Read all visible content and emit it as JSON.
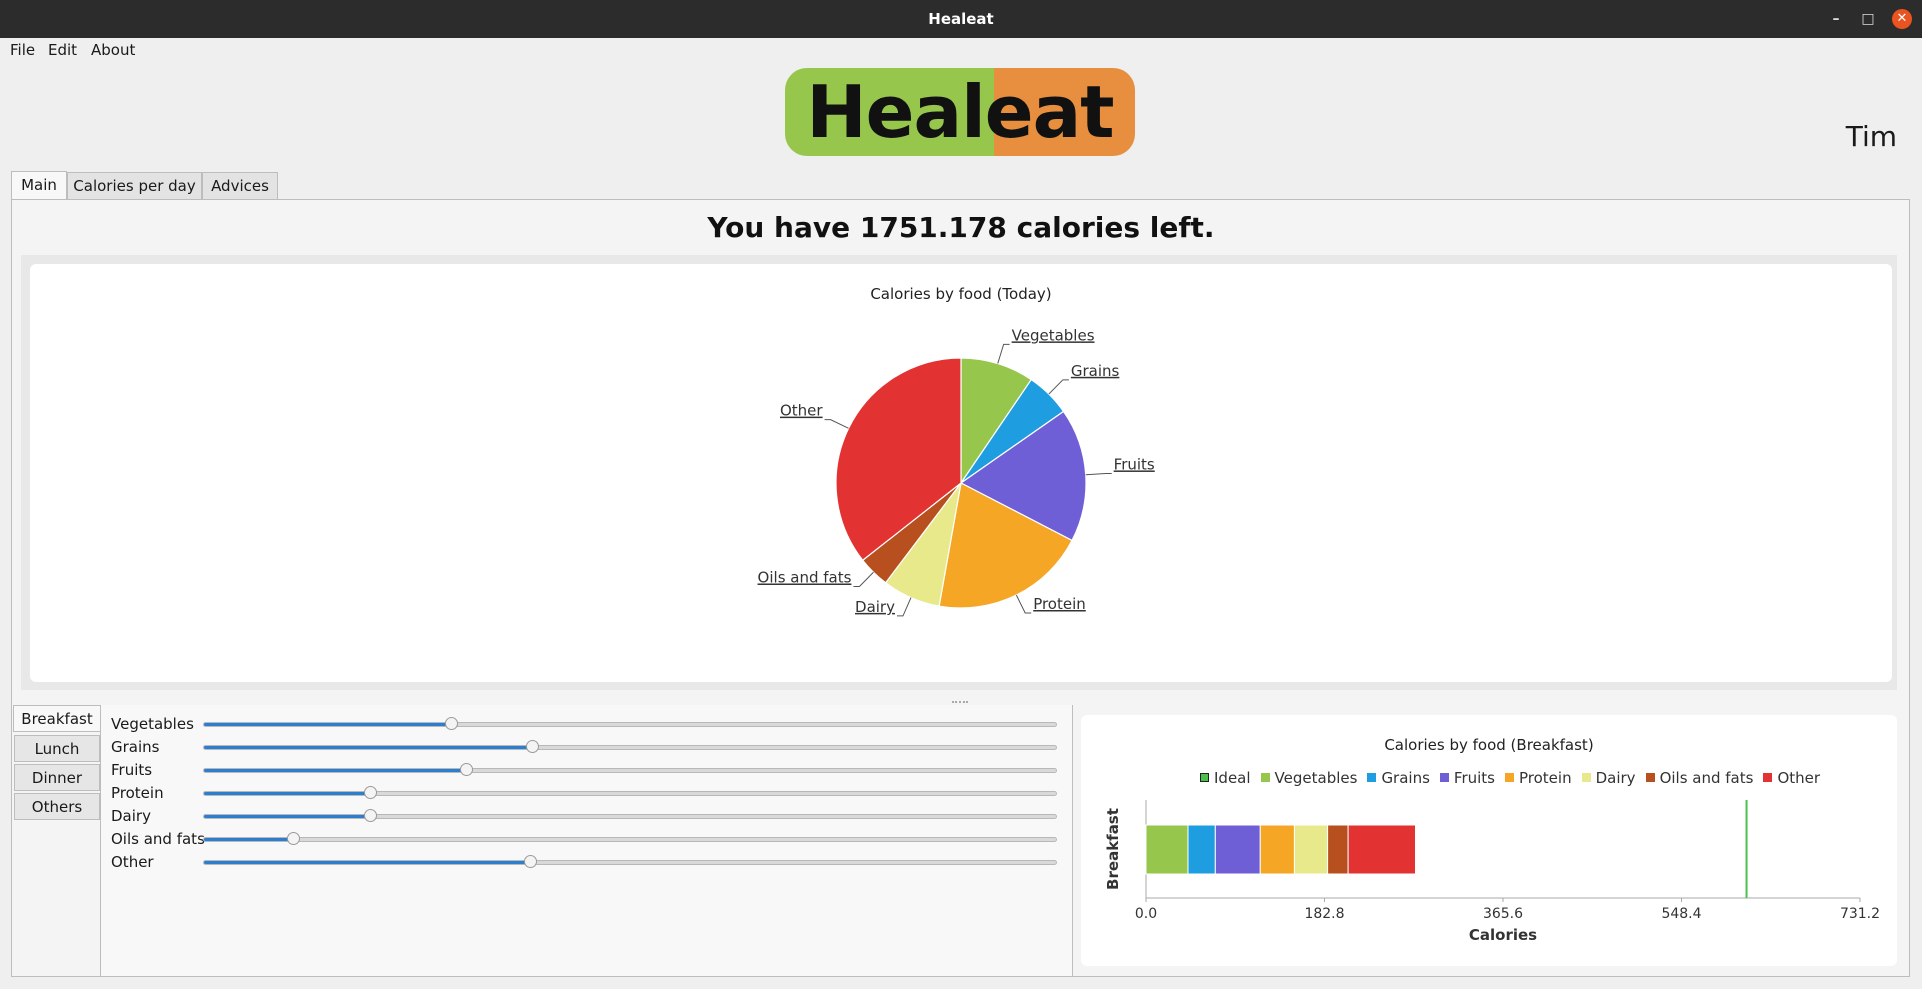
{
  "window": {
    "title": "Healeat"
  },
  "menu": {
    "file": "File",
    "edit": "Edit",
    "about": "About"
  },
  "logo_text": "Healeat",
  "user": {
    "name": "Tim"
  },
  "tabs": [
    "Main",
    "Calories per day",
    "Advices"
  ],
  "main": {
    "calories_left": "You have 1751.178 calories left."
  },
  "meal_tabs": [
    "Breakfast",
    "Lunch",
    "Dinner",
    "Others"
  ],
  "sliders": [
    {
      "label": "Vegetables",
      "value": 0.29
    },
    {
      "label": "Grains",
      "value": 0.385
    },
    {
      "label": "Fruits",
      "value": 0.308
    },
    {
      "label": "Protein",
      "value": 0.195
    },
    {
      "label": "Dairy",
      "value": 0.196
    },
    {
      "label": "Oils and fats",
      "value": 0.105
    },
    {
      "label": "Other",
      "value": 0.383
    }
  ],
  "colors": {
    "Vegetables": "#97c64d",
    "Grains": "#1e9ee0",
    "Fruits": "#6f5fd6",
    "Protein": "#f4a624",
    "Dairy": "#e8e98a",
    "Oils and fats": "#b84f1e",
    "Other": "#e23232",
    "Ideal": "#4cc04c"
  },
  "chart_data": [
    {
      "type": "pie",
      "title": "Calories by food (Today)",
      "categories": [
        "Vegetables",
        "Grains",
        "Fruits",
        "Protein",
        "Dairy",
        "Oils and fats",
        "Other"
      ],
      "values": [
        9.5,
        5.8,
        17.3,
        20.2,
        7.5,
        4.1,
        35.6
      ]
    },
    {
      "type": "bar",
      "orientation": "horizontal",
      "stacked": true,
      "title": "Calories by food (Breakfast)",
      "categories": [
        "Breakfast"
      ],
      "series": [
        {
          "name": "Vegetables",
          "values": [
            43
          ]
        },
        {
          "name": "Grains",
          "values": [
            28
          ]
        },
        {
          "name": "Fruits",
          "values": [
            46
          ]
        },
        {
          "name": "Protein",
          "values": [
            35
          ]
        },
        {
          "name": "Dairy",
          "values": [
            34
          ]
        },
        {
          "name": "Oils and fats",
          "values": [
            21
          ]
        },
        {
          "name": "Other",
          "values": [
            69
          ]
        }
      ],
      "ideal": {
        "name": "Ideal",
        "value": 615
      },
      "legend": [
        "Ideal",
        "Vegetables",
        "Grains",
        "Fruits",
        "Protein",
        "Dairy",
        "Oils and fats",
        "Other"
      ],
      "xlabel": "Calories",
      "ylabel": "Breakfast",
      "xlim": [
        0,
        731.2
      ],
      "xticks": [
        "0.0",
        "182.8",
        "365.6",
        "548.4",
        "731.2"
      ],
      "legend_position": "top"
    }
  ]
}
